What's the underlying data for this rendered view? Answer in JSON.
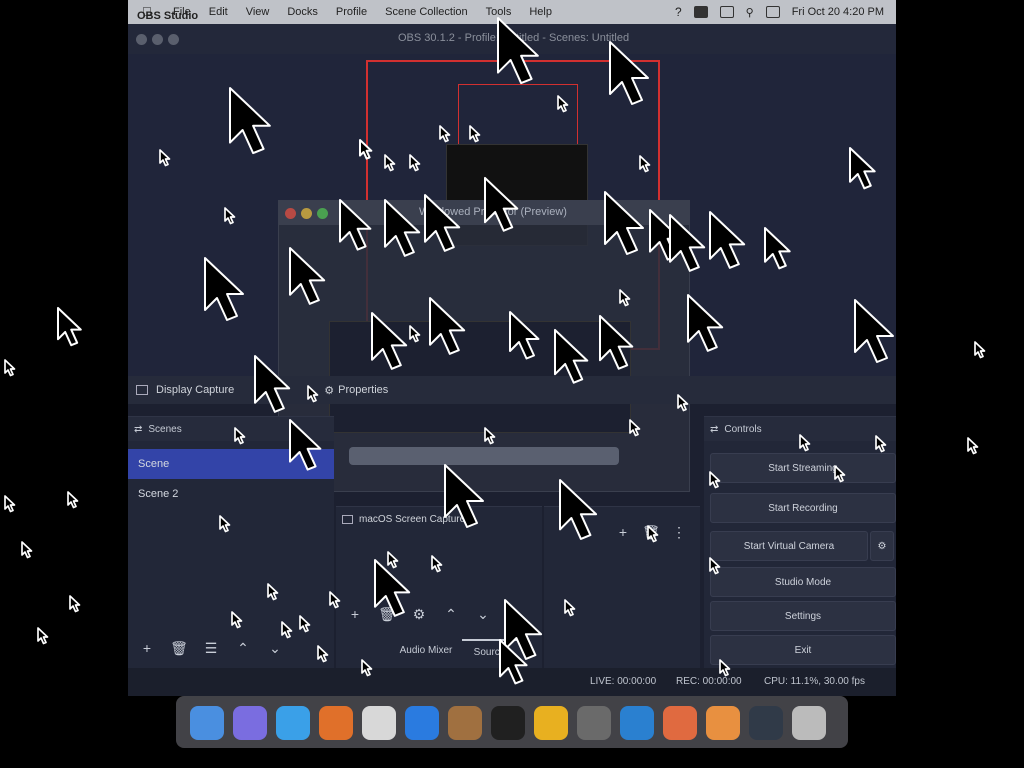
{
  "menubar": {
    "app_name": "OBS Studio",
    "items": [
      "File",
      "Edit",
      "View",
      "Docks",
      "Profile",
      "Scene Collection",
      "Tools",
      "Help"
    ],
    "clock": "Fri Oct 20 4:20 PM"
  },
  "window": {
    "title": "OBS 30.1.2 - Profile: Untitled - Scenes: Untitled"
  },
  "nested_preview": {
    "title": "Windowed Projector (Preview)"
  },
  "source_toolbar": {
    "source_name": "Display Capture",
    "properties_label": "Properties"
  },
  "scenes": {
    "header": "Scenes",
    "items": [
      {
        "label": "Scene",
        "selected": true
      },
      {
        "label": "Scene 2",
        "selected": false
      }
    ]
  },
  "sources": {
    "item_label": "macOS Screen Capture",
    "tabs": [
      "Audio Mixer",
      "Sources"
    ]
  },
  "controls": {
    "header": "Controls",
    "buttons": [
      "Start Streaming",
      "Start Recording",
      "Start Virtual Camera",
      "Studio Mode",
      "Settings",
      "Exit"
    ]
  },
  "statusbar": {
    "live": "LIVE: 00:00:00",
    "rec": "REC: 00:00:00",
    "cpu": "CPU: 11.1%, 30.00 fps"
  },
  "dock_apps": [
    "finder-app-icon",
    "launchpad-app-icon",
    "safari-app-icon",
    "firefox-app-icon",
    "notes-app-icon",
    "app-store-app-icon",
    "instruments-app-icon",
    "terminal-app-icon",
    "chrome-app-icon",
    "settings-app-icon",
    "vscode-app-icon",
    "pixelmator-app-icon",
    "keynote-app-icon",
    "obs-app-icon",
    "trash-app-icon"
  ]
}
